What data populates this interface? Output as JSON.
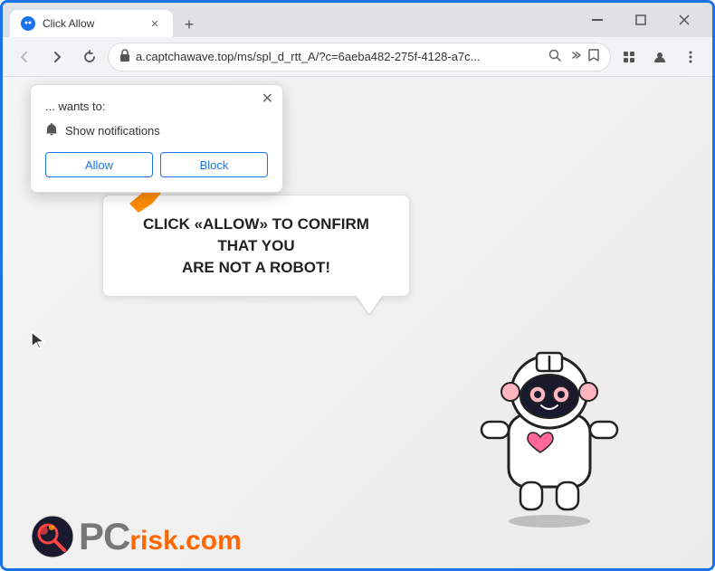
{
  "browser": {
    "title": "Click Allow",
    "tab_title": "Click Allow",
    "url": "a.captchawave.top/ms/spl_d_rtt_A/?c=6aeba482-275f-4128-a7c...",
    "new_tab_label": "+",
    "nav": {
      "back": "←",
      "forward": "→",
      "reload": "↺"
    },
    "window_controls": {
      "minimize": "—",
      "maximize": "□",
      "close": "✕"
    }
  },
  "notification_popup": {
    "site_text": "... wants to:",
    "close_label": "✕",
    "permission_text": "Show notifications",
    "allow_label": "Allow",
    "block_label": "Block"
  },
  "page": {
    "bubble_line1": "CLICK «ALLOW» TO CONFIRM THAT YOU",
    "bubble_line2": "ARE NOT A ROBOT!"
  },
  "logo": {
    "pc": "PC",
    "separator": "r",
    "risk": "isk.com"
  },
  "icons": {
    "lock": "🔒",
    "bell": "🔔",
    "search": "🔍",
    "share": "⇧",
    "star": "☆",
    "extensions": "▣",
    "profile": "👤",
    "menu": "⋮"
  },
  "colors": {
    "accent_blue": "#1a73e8",
    "tab_bg": "#ffffff",
    "toolbar_bg": "#f1f3f4",
    "chrome_bg": "#dee1e6"
  }
}
